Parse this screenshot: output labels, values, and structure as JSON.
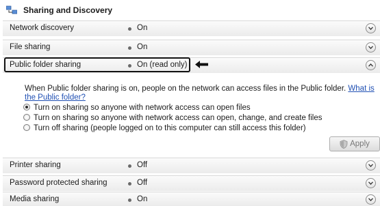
{
  "section": {
    "title": "Sharing and Discovery"
  },
  "rows_top": [
    {
      "label": "Network discovery",
      "value": "On"
    },
    {
      "label": "File sharing",
      "value": "On"
    },
    {
      "label": "Public folder sharing",
      "value": "On (read only)"
    }
  ],
  "expanded": {
    "description": "When Public folder sharing is on, people on the network can access files in the Public folder.",
    "link": "What is the Public folder?",
    "options": [
      {
        "label": "Turn on sharing so anyone with network access can open files",
        "checked": true
      },
      {
        "label": "Turn on sharing so anyone with network access can open, change, and create files",
        "checked": false
      },
      {
        "label": "Turn off sharing (people logged on to this computer can still access this folder)",
        "checked": false
      }
    ],
    "apply_label": "Apply"
  },
  "rows_bottom": [
    {
      "label": "Printer sharing",
      "value": "Off"
    },
    {
      "label": "Password protected sharing",
      "value": "Off"
    },
    {
      "label": "Media sharing",
      "value": "On"
    }
  ],
  "icons": {
    "section": "network-sharing-icon",
    "expand": "chevron-down-icon",
    "collapse": "chevron-up-icon",
    "callout": "left-arrow-icon",
    "apply": "shield-icon"
  }
}
